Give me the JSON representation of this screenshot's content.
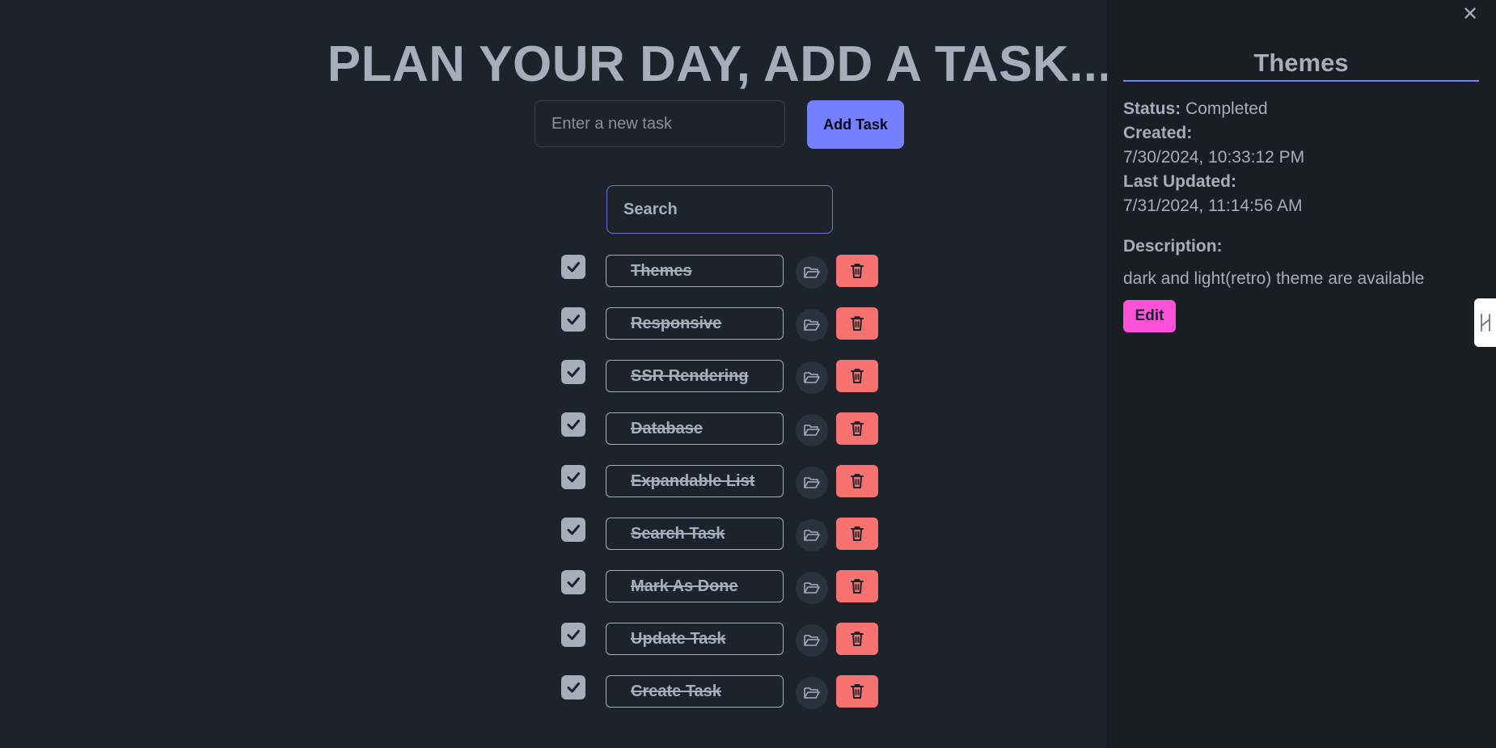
{
  "header": {
    "title": "PLAN YOUR DAY, ADD A TASK..."
  },
  "new_task": {
    "placeholder": "Enter a new task",
    "add_label": "Add Task"
  },
  "search": {
    "placeholder": "Search"
  },
  "tasks": [
    {
      "name": "Themes",
      "completed": true
    },
    {
      "name": "Responsive",
      "completed": true
    },
    {
      "name": "SSR Rendering",
      "completed": true
    },
    {
      "name": "Database",
      "completed": true
    },
    {
      "name": "Expandable List",
      "completed": true
    },
    {
      "name": "Search Task",
      "completed": true
    },
    {
      "name": "Mark As Done",
      "completed": true
    },
    {
      "name": "Update Task",
      "completed": true
    },
    {
      "name": "Create Task",
      "completed": true
    }
  ],
  "details": {
    "title": "Themes",
    "status_label": "Status:",
    "status_value": "Completed",
    "created_label": "Created:",
    "created_value": "7/30/2024, 10:33:12 PM",
    "updated_label": "Last Updated:",
    "updated_value": "7/31/2024, 11:14:56 AM",
    "description_label": "Description:",
    "description_value": "dark and light(retro) theme are available",
    "edit_label": "Edit",
    "close_glyph": "✕"
  },
  "colors": {
    "background": "#1d232a",
    "panel": "#191e24",
    "primary": "#7480ff",
    "error": "#f87272",
    "secondary": "#ff52d9",
    "text": "#a6adbb"
  },
  "icons": {
    "checkbox": "check-icon",
    "open": "open-folder-icon",
    "delete": "trash-icon",
    "close": "close-icon",
    "handle": "drawer-handle-icon"
  }
}
